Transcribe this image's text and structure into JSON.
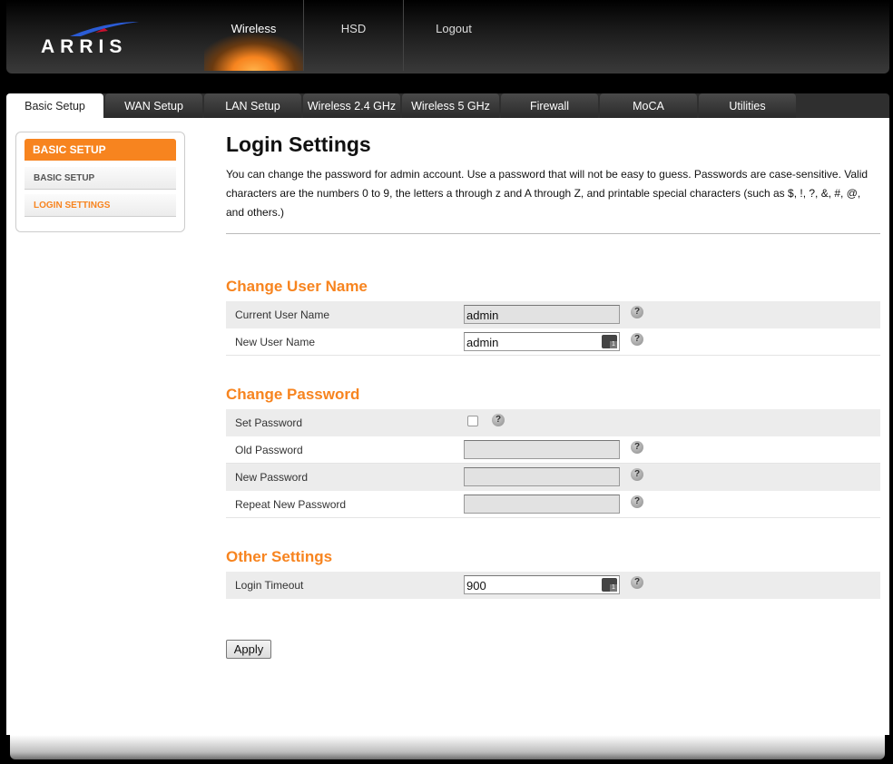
{
  "brand": {
    "logo_text": "ARRIS"
  },
  "top_nav": [
    {
      "label": "Wireless",
      "active": true
    },
    {
      "label": "HSD",
      "active": false
    },
    {
      "label": "Logout",
      "active": false
    }
  ],
  "tabs": [
    {
      "label": "Basic Setup",
      "active": true
    },
    {
      "label": "WAN Setup"
    },
    {
      "label": "LAN Setup"
    },
    {
      "label": "Wireless 2.4 GHz"
    },
    {
      "label": "Wireless 5 GHz"
    },
    {
      "label": "Firewall"
    },
    {
      "label": "MoCA"
    },
    {
      "label": "Utilities"
    }
  ],
  "sidebar": {
    "header": "BASIC SETUP",
    "items": [
      {
        "label": "BASIC SETUP",
        "active": false
      },
      {
        "label": "LOGIN SETTINGS",
        "active": true
      }
    ]
  },
  "page": {
    "title": "Login Settings",
    "intro": "You can change the password for admin account. Use a password that will not be easy to guess. Passwords are case-sensitive. Valid characters are the numbers 0 to 9, the letters a through z and A through Z, and printable special characters (such as $, !, ?, &, #, @, and others.)"
  },
  "change_user": {
    "title": "Change User Name",
    "current_label": "Current User Name",
    "current_value": "admin",
    "new_label": "New User Name",
    "new_value": "admin"
  },
  "change_password": {
    "title": "Change Password",
    "set_label": "Set Password",
    "old_label": "Old Password",
    "new_label": "New Password",
    "repeat_label": "Repeat New Password"
  },
  "other": {
    "title": "Other Settings",
    "timeout_label": "Login Timeout",
    "timeout_value": "900"
  },
  "help_glyph": "?",
  "apply_label": "Apply",
  "colors": {
    "accent": "#f7841f",
    "header_bg": "#1a1a1a",
    "row_shade": "#ececec"
  }
}
